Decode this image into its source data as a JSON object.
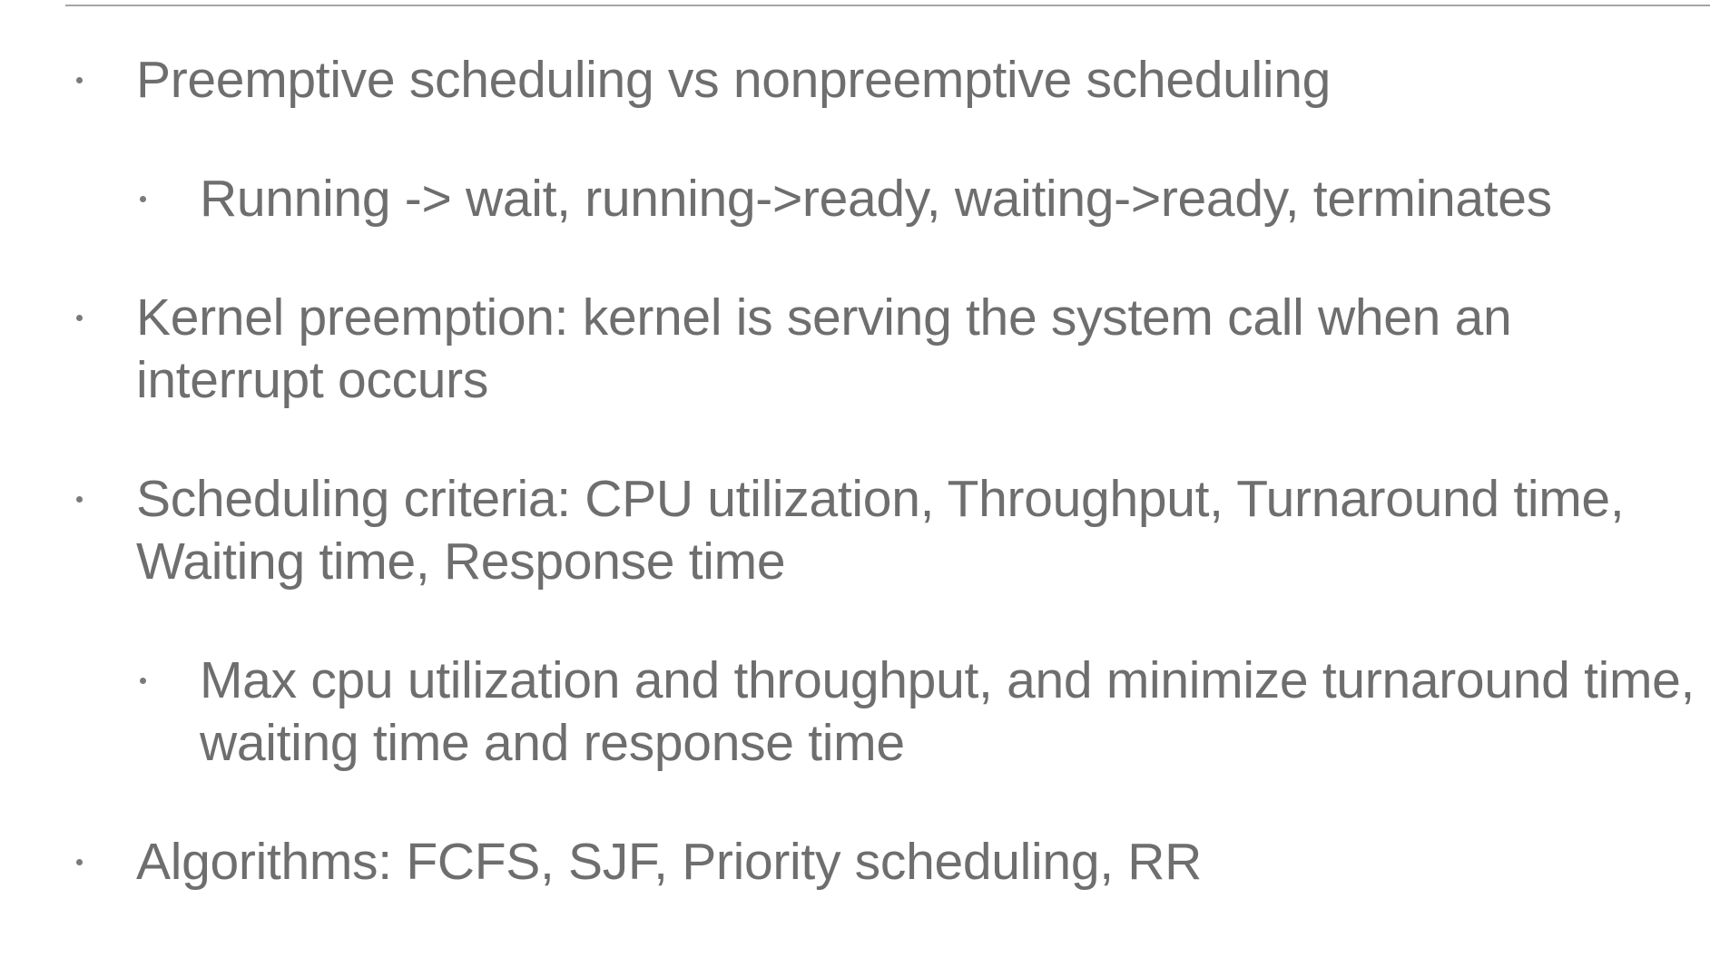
{
  "slide": {
    "bullets": [
      {
        "text": "Preemptive scheduling vs nonpreemptive scheduling"
      },
      {
        "text": "Running -> wait, running->ready, waiting->ready, terminates"
      },
      {
        "line1": "Kernel preemption: kernel is serving the system call when an",
        "line2": "interrupt occurs"
      },
      {
        "line1": "Scheduling criteria: CPU utilization, Throughput, Turnaround time,",
        "line2": "Waiting time, Response time"
      },
      {
        "line1": "Max cpu utilization and throughput, and minimize turnaround time,",
        "line2": "waiting time and response time"
      },
      {
        "text": "Algorithms: FCFS, SJF, Priority scheduling, RR"
      }
    ]
  }
}
